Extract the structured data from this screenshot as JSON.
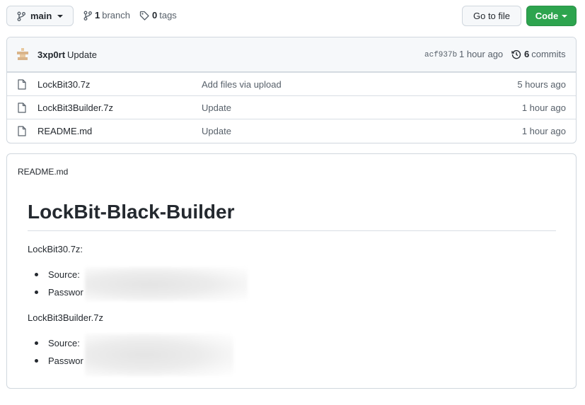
{
  "topbar": {
    "branch_label": "main",
    "branch_count": "1",
    "branch_word": "branch",
    "tag_count": "0",
    "tag_word": "tags",
    "goto_file": "Go to file",
    "code": "Code"
  },
  "commit": {
    "author": "3xp0rt",
    "message": "Update",
    "sha": "acf937b",
    "time": "1 hour ago",
    "count": "6",
    "count_word": "commits"
  },
  "files": [
    {
      "name": "LockBit30.7z",
      "message": "Add files via upload",
      "age": "5 hours ago"
    },
    {
      "name": "LockBit3Builder.7z",
      "message": "Update",
      "age": "1 hour ago"
    },
    {
      "name": "README.md",
      "message": "Update",
      "age": "1 hour ago"
    }
  ],
  "readme": {
    "header": "README.md",
    "title": "LockBit-Black-Builder",
    "section1": "LockBit30.7z:",
    "section1_items": [
      "Source:",
      "Passwor"
    ],
    "section2": "LockBit3Builder.7z",
    "section2_items": [
      "Source:",
      "Passwor"
    ]
  },
  "colors": {
    "code_button": "#2da44e",
    "border": "#d0d7de",
    "muted_text": "#57606a"
  },
  "icons": [
    "git-branch-icon",
    "tag-icon",
    "history-icon",
    "file-icon",
    "caret-down-icon"
  ]
}
